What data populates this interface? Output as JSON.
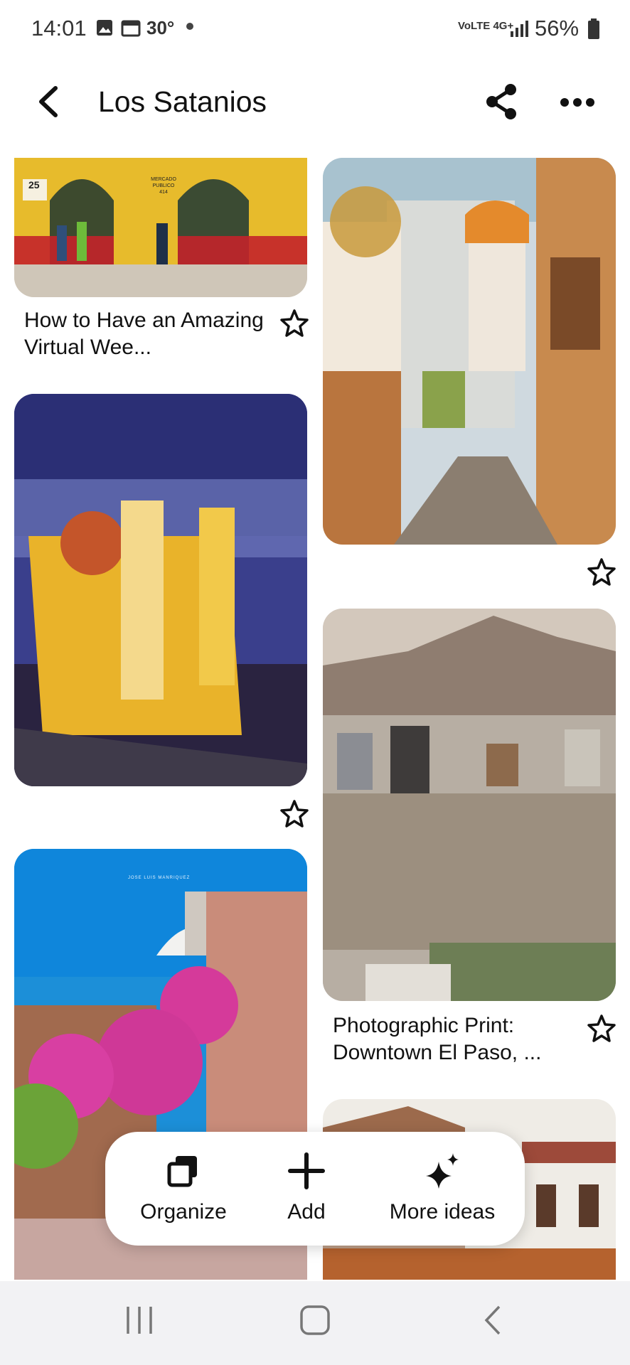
{
  "status_bar": {
    "time": "14:01",
    "temperature": "30°",
    "network": "VoLTE 4G+",
    "battery": "56%"
  },
  "header": {
    "title": "Los Satanios",
    "back_icon": "back-arrow-icon",
    "share_icon": "share-icon",
    "more_icon": "more-icon"
  },
  "pins": [
    {
      "caption": "How to Have an Amazing Virtual Wee...",
      "image_text": "MERCADO PUBLICO 414",
      "number_sign": "25"
    },
    {
      "caption": ""
    },
    {
      "caption": ""
    },
    {
      "caption": "Photographic Print: Downtown El Paso, ..."
    },
    {
      "caption": "",
      "watermark": "JOSE LUIS MANRIQUEZ"
    },
    {
      "caption": ""
    }
  ],
  "action_bar": {
    "organize": "Organize",
    "add": "Add",
    "more_ideas": "More ideas"
  },
  "colors": {
    "accent": "#111111",
    "background": "#ffffff",
    "navbar": "#f2f2f4"
  }
}
